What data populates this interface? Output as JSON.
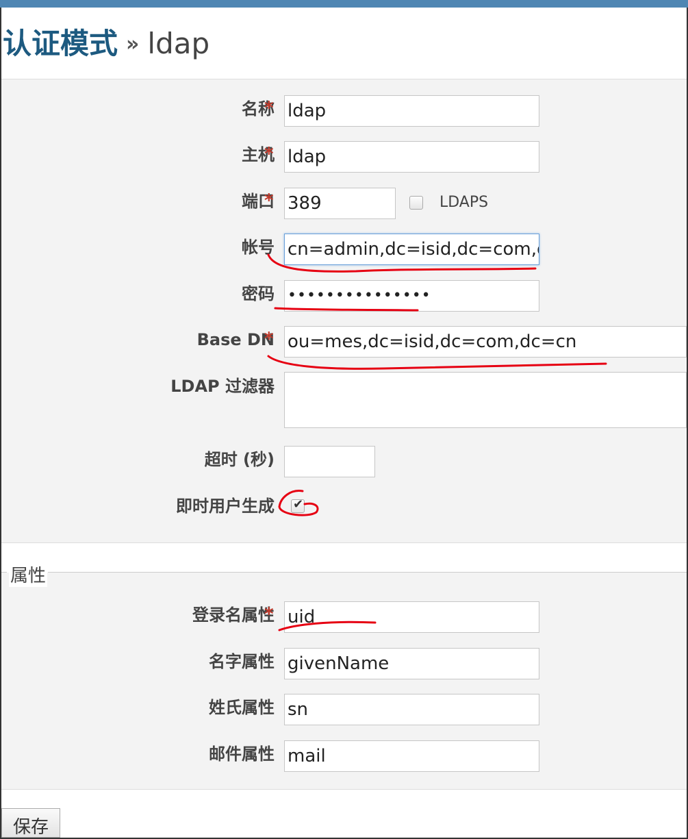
{
  "header": {
    "title": "认证模式",
    "separator": "»",
    "subtitle": "ldap"
  },
  "form": {
    "name": {
      "label": "名称",
      "value": "ldap",
      "required": true
    },
    "host": {
      "label": "主机",
      "value": "ldap",
      "required": true
    },
    "port": {
      "label": "端口",
      "value": "389",
      "required": true
    },
    "ldaps": {
      "label": "LDAPS",
      "checked": false
    },
    "account": {
      "label": "帐号",
      "value": "cn=admin,dc=isid,dc=com,d"
    },
    "password": {
      "label": "密码",
      "value": "•••••••••••••••"
    },
    "base_dn": {
      "label": "Base DN",
      "value": "ou=mes,dc=isid,dc=com,dc=cn",
      "required": true
    },
    "ldap_filter": {
      "label": "LDAP 过滤器",
      "value": ""
    },
    "timeout": {
      "label": "超时 (秒)",
      "value": ""
    },
    "onthefly": {
      "label": "即时用户生成",
      "checked": true
    },
    "required_marker": "*"
  },
  "attributes": {
    "legend": "属性",
    "login": {
      "label": "登录名属性",
      "value": "uid",
      "required": true
    },
    "firstname": {
      "label": "名字属性",
      "value": "givenName"
    },
    "lastname": {
      "label": "姓氏属性",
      "value": "sn"
    },
    "mail": {
      "label": "邮件属性",
      "value": "mail"
    }
  },
  "actions": {
    "save_label": "保存"
  },
  "colors": {
    "header_bar": "#4f86b3",
    "title": "#1d5a80",
    "required": "#c0392b",
    "annotation": "#e60012"
  }
}
